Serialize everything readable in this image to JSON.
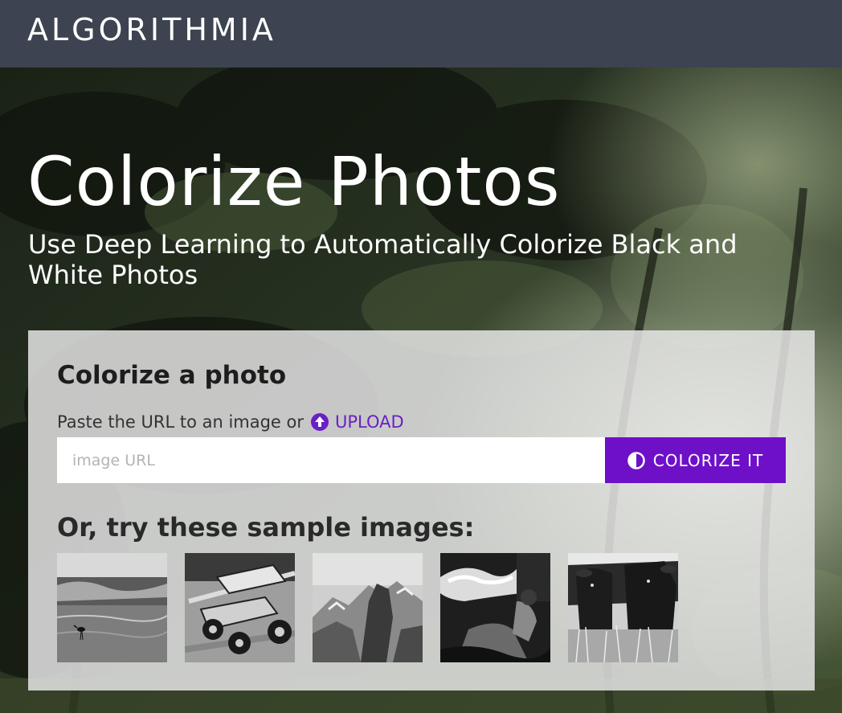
{
  "header": {
    "logo_text": "ALGORITHMIA",
    "background_color": "#3d4350"
  },
  "hero": {
    "title": "Colorize Photos",
    "subtitle": "Use Deep Learning to Automatically Colorize Black and White Photos",
    "background_icon": "forest-photo"
  },
  "card": {
    "title": "Colorize a photo",
    "paste_label": "Paste the URL to an image or",
    "upload_label": "UPLOAD",
    "upload_icon": "upload-circle-icon",
    "url_input": {
      "placeholder": "image URL",
      "value": ""
    },
    "colorize_button_label": "COLORIZE IT",
    "colorize_button_icon": "contrast-icon",
    "samples_heading": "Or, try these sample images:",
    "samples": [
      {
        "icon": "bird-on-shore-photo"
      },
      {
        "icon": "sprint-race-car-photo"
      },
      {
        "icon": "half-dome-mountain-photo"
      },
      {
        "icon": "fire-breather-photo"
      },
      {
        "icon": "cows-in-grass-photo"
      }
    ]
  },
  "colors": {
    "accent": "#6f10c9",
    "link": "#6b1fc7",
    "card_background": "#e8e8e8"
  }
}
